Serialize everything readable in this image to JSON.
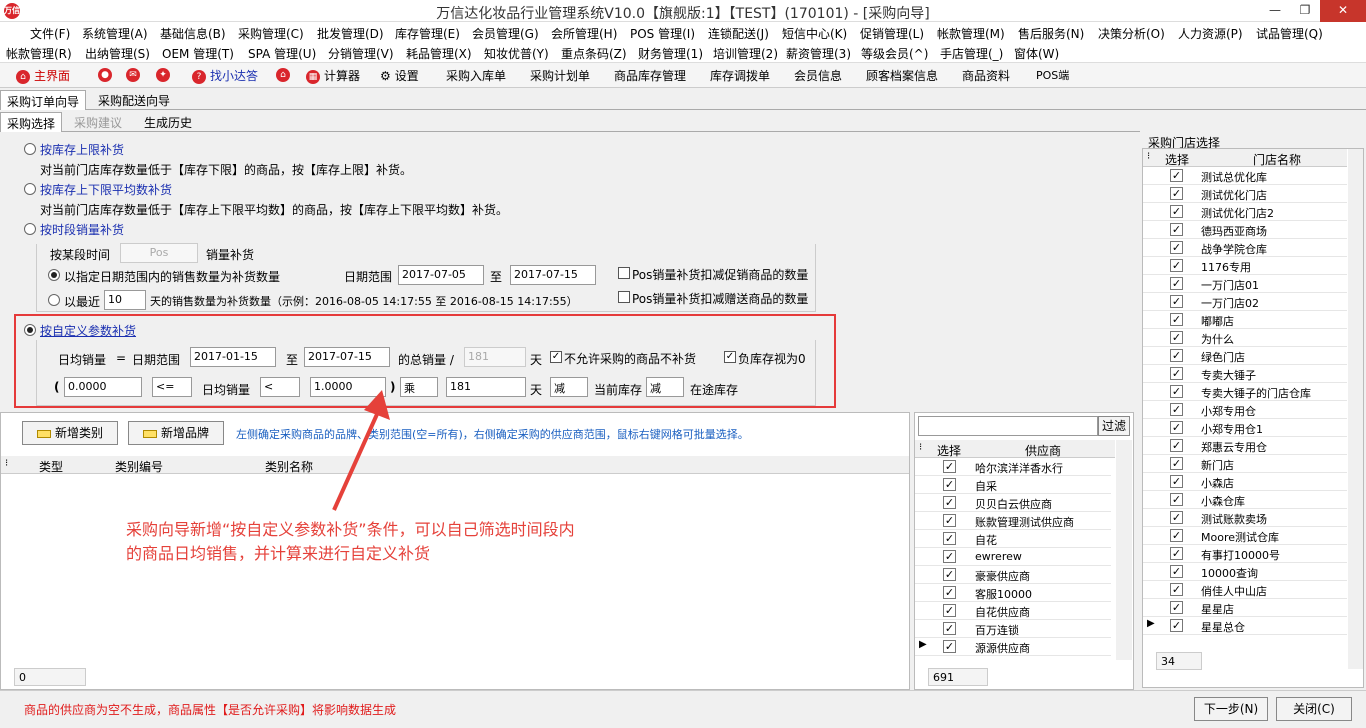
{
  "window": {
    "title": "万信达化妆品行业管理系统V10.0【旗舰版:1】【TEST】(170101) - [采购向导]",
    "logo_text": "万信"
  },
  "menu_row1": [
    "文件(F)",
    "系统管理(A)",
    "基础信息(B)",
    "采购管理(C)",
    "批发管理(D)",
    "库存管理(E)",
    "会员管理(G)",
    "会所管理(H)",
    "POS 管理(I)",
    "连锁配送(J)",
    "短信中心(K)",
    "促销管理(L)",
    "帐款管理(M)",
    "售后服务(N)",
    "决策分析(O)",
    "人力资源(P)",
    "试品管理(Q)"
  ],
  "menu_row2": [
    "帐款管理(R)",
    "出纳管理(S)",
    "OEM 管理(T)",
    "SPA 管理(U)",
    "分销管理(V)",
    "耗品管理(X)",
    "知妆优普(Y)",
    "重点条码(Z)",
    "财务管理(1)",
    "培训管理(2)",
    "薪资管理(3)",
    "等级会员(^)",
    "手店管理(_)",
    "窗体(W)"
  ],
  "toolbar": {
    "home": "主界面",
    "assistant": "找小达答",
    "calculator": "计算器",
    "settings": "设置",
    "items": [
      "采购入库单",
      "采购计划单",
      "商品库存管理",
      "库存调拨单",
      "会员信息",
      "顾客档案信息",
      "商品资料",
      "POS端"
    ]
  },
  "tabs_top": [
    "采购订单向导",
    "采购配送向导"
  ],
  "tabs_sub": [
    "采购选择",
    "采购建议",
    "生成历史"
  ],
  "options": {
    "opt1_label": "按库存上限补货",
    "opt1_desc": "对当前门店库存数量低于【库存下限】的商品，按【库存上限】补货。",
    "opt2_label": "按库存上下限平均数补货",
    "opt2_desc": "对当前门店库存数量低于【库存上下限平均数】的商品，按【库存上下限平均数】补货。",
    "opt3_label": "按时段销量补货",
    "period_label": "按某段时间",
    "period_value": "Pos",
    "period_suffix": "销量补货",
    "sub1_label": "以指定日期范围内的销售数量为补货数量",
    "date_range_label": "日期范围",
    "date_from": "2017-07-05",
    "to": "至",
    "date_to": "2017-07-15",
    "pos_promo": "Pos销量补货扣减促销商品的数量",
    "sub2_prefix": "以最近",
    "recent_days": "10",
    "sub2_suffix": "天的销售数量为补货数量（示例：2016-08-05 14:17:55 至 2016-08-15 14:17:55）",
    "pos_gift": "Pos销量补货扣减赠送商品的数量",
    "opt4_label": "按自定义参数补货",
    "daily_label": "日均销量",
    "eq": "=",
    "range_label": "日期范围",
    "custom_from": "2017-01-15",
    "custom_to": "2017-07-15",
    "total_label": "的总销量 /",
    "days_value": "181",
    "day_unit": "天",
    "no_purchase": "不允许采购的商品不补货",
    "neg_stock": "负库存视为0",
    "paren_open": "(",
    "lower_value": "0.0000",
    "op1": "<=",
    "daily2": "日均销量",
    "op2": "<",
    "upper_value": "1.0000",
    "paren_close": ")",
    "mult": "乘",
    "mult_days": "181",
    "minus1": "减",
    "current_stock": "当前库存",
    "minus2": "减",
    "transit": "在途库存"
  },
  "category": {
    "add_category": "新增类别",
    "add_brand": "新增品牌",
    "hint": "左侧确定采购商品的品牌、类别范围(空=所有)，右侧确定采购的供应商范围，鼠标右键网格可批量选择。",
    "columns": [
      "类型",
      "类别编号",
      "类别名称"
    ],
    "count": "0"
  },
  "annotation": {
    "line1": "采购向导新增“按自定义参数补货”条件，可以自己筛选时间段内",
    "line2": "的商品日均销售，并计算来进行自定义补货"
  },
  "supplier": {
    "filter_button": "过滤",
    "columns": [
      "选择",
      "供应商"
    ],
    "rows": [
      "哈尔滨洋洋香水行",
      "自采",
      "贝贝白云供应商",
      "账款管理测试供应商",
      "自花",
      "ewrerew",
      "豪豪供应商",
      "客服10000",
      "自花供应商",
      "百万连锁",
      "源源供应商"
    ],
    "count": "691"
  },
  "store": {
    "section_title": "采购门店选择",
    "columns": [
      "选择",
      "门店名称"
    ],
    "rows": [
      "测试总优化库",
      "测试优化门店",
      "测试优化门店2",
      "德玛西亚商场",
      "战争学院仓库",
      "1176专用",
      "一万门店01",
      "一万门店02",
      "嘟嘟店",
      "为什么",
      "绿色门店",
      "专卖大锤子",
      "专卖大锤子的门店仓库",
      "小郑专用仓",
      "小郑专用仓1",
      "郑惠云专用仓",
      "新门店",
      "小森店",
      "小森仓库",
      "测试账款卖场",
      "Moore测试仓库",
      "有事打10000号",
      "10000查询",
      "俏佳人中山店",
      "星星店",
      "星星总仓"
    ],
    "count": "34"
  },
  "status": {
    "message": "商品的供应商为空不生成，商品属性【是否允许采购】将影响数据生成",
    "next": "下一步(N)",
    "close": "关闭(C)"
  }
}
